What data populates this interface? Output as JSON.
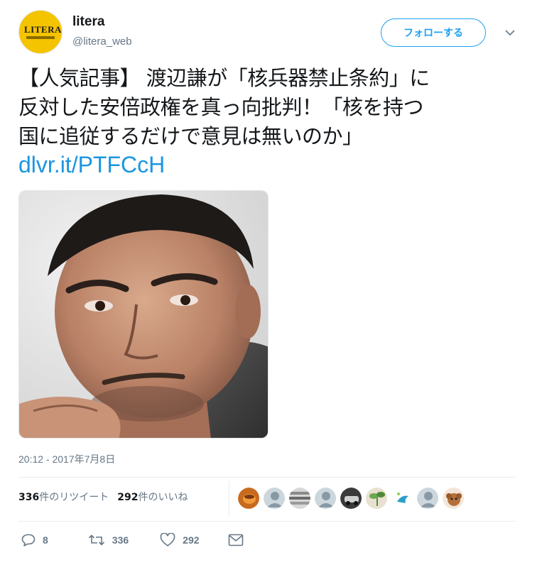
{
  "user": {
    "avatar_logo_text": "LITERA",
    "name": "litera",
    "handle": "@litera_web"
  },
  "follow_button": "フォローする",
  "tweet": {
    "lines": [
      "【人気記事】 渡辺謙が「核兵器禁止条約」に",
      "反対した安倍政権を真っ向批判！「核を持つ",
      "国に追従するだけで意見は無いのか」"
    ],
    "link": "dlvr.it/PTFCcH"
  },
  "timestamp": "20:12 - 2017年7月8日",
  "stats": {
    "retweet_count": "336",
    "retweet_label": "件のリツイート",
    "like_count": "292",
    "like_label": "件のいいね"
  },
  "liker_avatars": [
    "orange-cup",
    "default-gray",
    "striped-pattern",
    "default-gray",
    "dark-car",
    "green-plant",
    "blue-bird",
    "default-gray",
    "brown-dog"
  ],
  "actions": {
    "reply_count": "8",
    "retweet_count": "336",
    "like_count": "292"
  },
  "colors": {
    "accent": "#1da1f2",
    "link": "#1b95e0",
    "text": "#14171a",
    "secondary": "#657786",
    "avatar_yellow": "#f5c400"
  }
}
